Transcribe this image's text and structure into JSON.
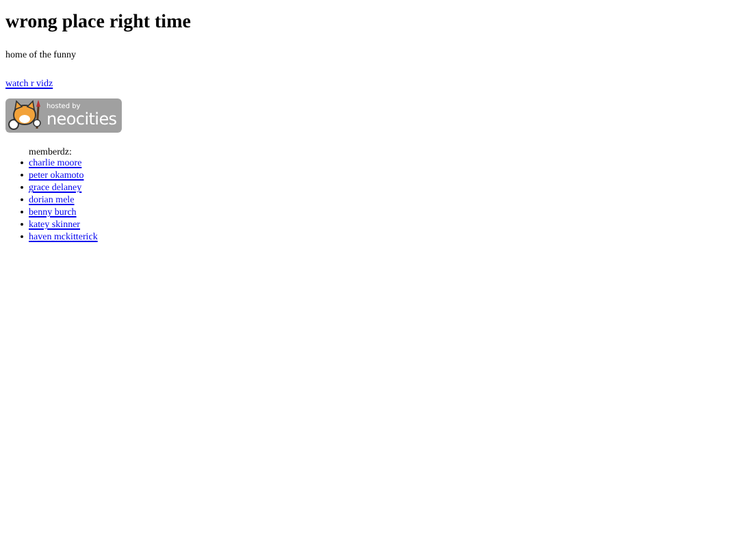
{
  "title": "wrong place right time",
  "tagline": "home of the funny",
  "video_link": "watch r vidz",
  "badge": {
    "top": "hosted by",
    "bottom": "neocities"
  },
  "members": {
    "label": "memberdz:",
    "items": [
      "charlie moore",
      "peter okamoto",
      "grace delaney",
      "dorian mele",
      "benny burch",
      "katey skinner",
      "haven mckitterick"
    ]
  }
}
